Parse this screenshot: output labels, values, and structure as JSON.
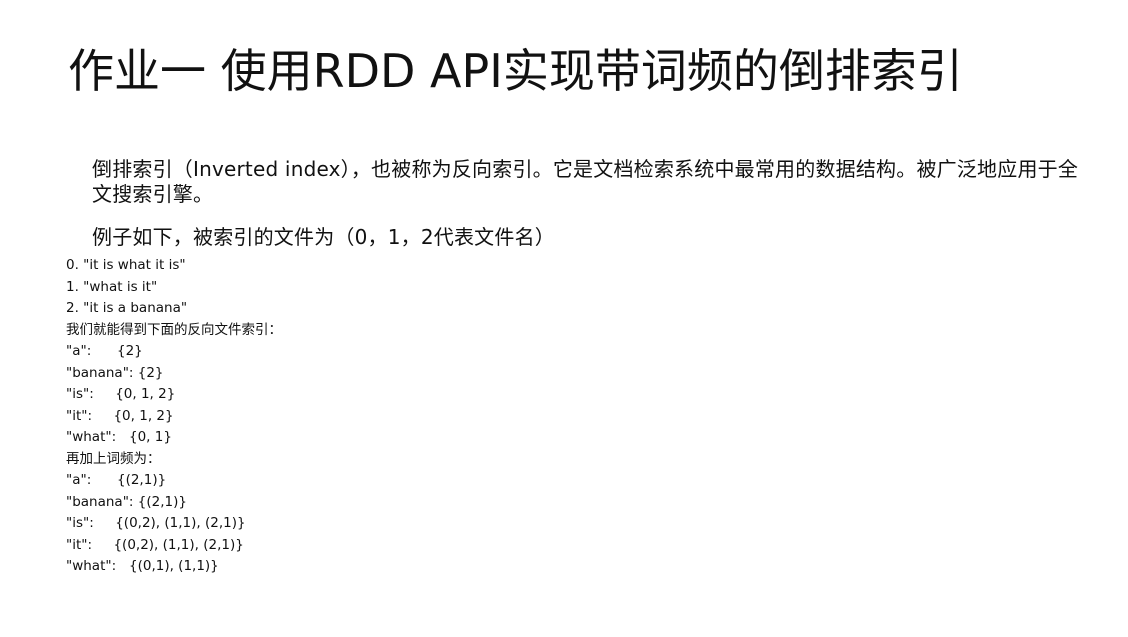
{
  "slide": {
    "title": "作业一 使用RDD API实现带词频的倒排索引",
    "paragraphs": [
      "倒排索引（Inverted index），也被称为反向索引。它是文档检索系统中最常用的数据结构。被广泛地应用于全文搜索引擎。",
      "例子如下，被索引的文件为（0，1，2代表文件名）"
    ],
    "lines": [
      "0. \"it is what it is\"",
      "1. \"what is it\"",
      "2. \"it is a banana\"",
      "我们就能得到下面的反向文件索引：",
      "\"a\":      {2}",
      "\"banana\": {2}",
      "\"is\":     {0, 1, 2}",
      "\"it\":     {0, 1, 2}",
      "\"what\":   {0, 1}",
      "再加上词频为：",
      "\"a\":      {(2,1)}",
      "\"banana\": {(2,1)}",
      "\"is\":     {(0,2), (1,1), (2,1)}",
      "\"it\":     {(0,2), (1,1), (2,1)}",
      "\"what\":   {(0,1), (1,1)}"
    ]
  }
}
